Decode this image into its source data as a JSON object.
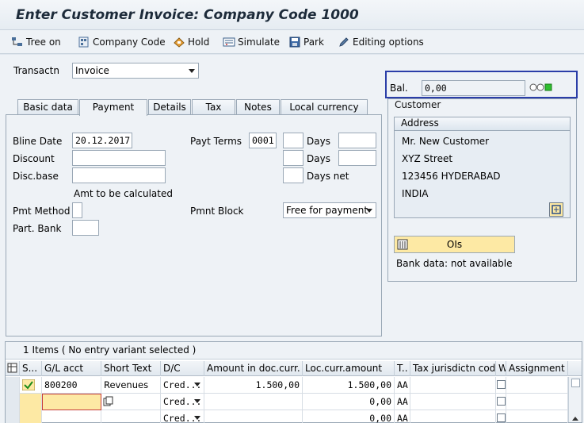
{
  "window": {
    "title": "Enter Customer Invoice: Company Code 1000"
  },
  "toolbar": {
    "tree_on": "Tree on",
    "company_code": "Company Code",
    "hold": "Hold",
    "simulate": "Simulate",
    "park": "Park",
    "editing_options": "Editing options"
  },
  "header": {
    "transaction_label": "Transactn",
    "transaction_value": "Invoice",
    "balance_label": "Bal.",
    "balance_value": "0,00"
  },
  "tabs": [
    "Basic data",
    "Payment",
    "Details",
    "Tax",
    "Notes",
    "Local currency"
  ],
  "payment": {
    "bline_date_label": "Bline Date",
    "bline_date_value": "20.12.2017",
    "discount_label": "Discount",
    "disc_base_label": "Disc.base",
    "amt_note": "Amt to be calculated",
    "pmt_method_label": "Pmt Method",
    "part_bank_label": "Part. Bank",
    "payt_terms_label": "Payt Terms",
    "payt_terms_value": "0001",
    "days1_label": "Days",
    "days2_label": "Days",
    "days_net_label": "Days net",
    "pmnt_block_label": "Pmnt Block",
    "pmnt_block_value": "Free for payment"
  },
  "customer": {
    "section_label": "Customer",
    "address_label": "Address",
    "name": "Mr. New Customer",
    "street": "XYZ Street",
    "city": "123456 HYDERABAD",
    "country": "INDIA",
    "ois_button": "OIs",
    "bank_data": "Bank data: not available"
  },
  "items": {
    "title": "1 Items ( No entry variant selected )",
    "columns": [
      "S...",
      "G/L acct",
      "Short Text",
      "D/C",
      "Amount in doc.curr.",
      "Loc.curr.amount",
      "T..",
      "Tax jurisdictn code",
      "W",
      "Assignment"
    ],
    "rows": [
      {
        "gl": "800200",
        "text": "Revenues",
        "dc": "Cred...",
        "amount": "1.500,00",
        "loc": "1.500,00",
        "tax": "AA"
      },
      {
        "gl": "",
        "text": "",
        "dc": "Cred...",
        "amount": "",
        "loc": "0,00",
        "tax": "AA"
      },
      {
        "gl": "",
        "text": "",
        "dc": "Cred...",
        "amount": "",
        "loc": "0,00",
        "tax": "AA"
      }
    ]
  },
  "colors": {
    "accent_frame": "#2b3ea8",
    "status_green": "#2fbf2f",
    "yellow_button": "#fde9a4"
  }
}
